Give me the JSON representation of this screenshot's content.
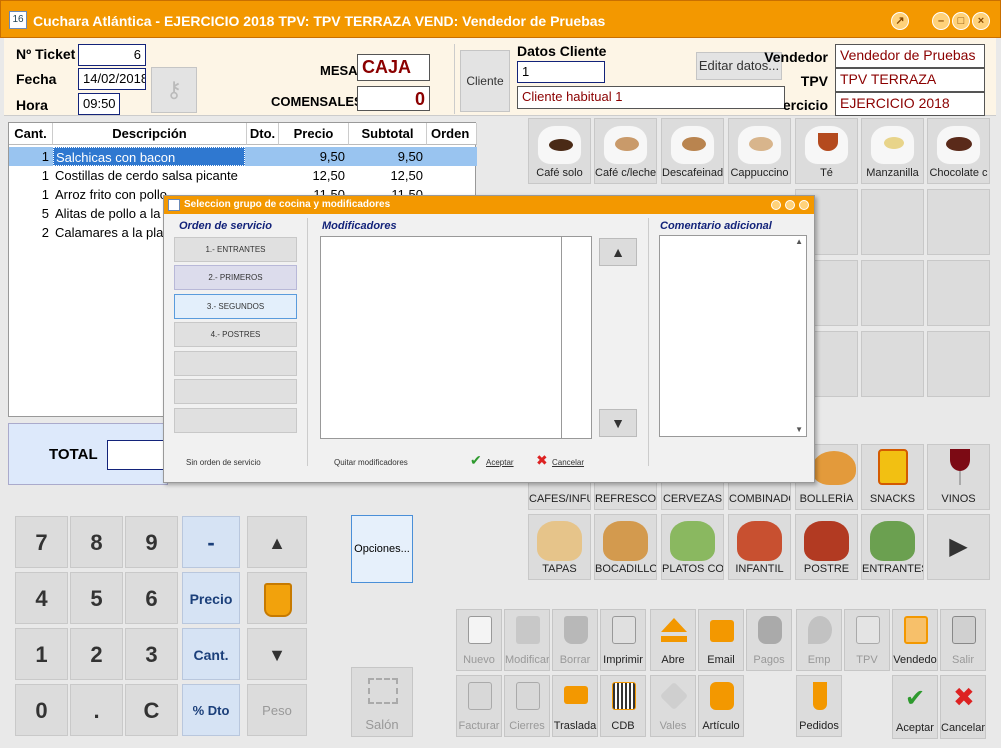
{
  "window": {
    "title": "Cuchara Atlántica - EJERCICIO 2018 TPV: TPV TERRAZA VEND: Vendedor de Pruebas"
  },
  "header": {
    "ticket_label": "Nº Ticket",
    "ticket_value": "6",
    "fecha_label": "Fecha",
    "fecha_value": "14/02/2018",
    "hora_label": "Hora",
    "hora_value": "09:50",
    "mesa_label": "MESA",
    "mesa_value": "CAJA",
    "comensales_label": "COMENSALES",
    "comensales_value": "0",
    "cliente_button": "Cliente",
    "datos_cliente_label": "Datos Cliente",
    "cliente_id": "1",
    "cliente_name": "Cliente habitual 1",
    "editar_button": "Editar datos...",
    "vendedor_label": "Vendedor",
    "vendedor_value": "Vendedor de Pruebas",
    "tpv_label": "TPV",
    "tpv_value": "TPV TERRAZA",
    "ejercicio_label": "Ejercicio",
    "ejercicio_value": "EJERCICIO 2018"
  },
  "table": {
    "columns": [
      "Cant.",
      "Descripción",
      "Dto.",
      "Precio",
      "Subtotal",
      "Orden"
    ],
    "rows": [
      {
        "cant": "1",
        "desc": "Salchicas con bacon",
        "dto": "",
        "precio": "9,50",
        "subtotal": "9,50"
      },
      {
        "cant": "1",
        "desc": "Costillas de cerdo salsa picante",
        "dto": "",
        "precio": "12,50",
        "subtotal": "12,50"
      },
      {
        "cant": "1",
        "desc": "Arroz frito con pollo",
        "dto": "",
        "precio": "11,50",
        "subtotal": "11,50"
      },
      {
        "cant": "5",
        "desc": "Alitas de pollo a la",
        "dto": "",
        "precio": "",
        "subtotal": ""
      },
      {
        "cant": "2",
        "desc": "Calamares a la pla",
        "dto": "",
        "precio": "",
        "subtotal": ""
      }
    ]
  },
  "total_label": "TOTAL",
  "keypad": {
    "k7": "7",
    "k8": "8",
    "k9": "9",
    "minus": "-",
    "k4": "4",
    "k5": "5",
    "k6": "6",
    "precio": "Precio",
    "k1": "1",
    "k2": "2",
    "k3": "3",
    "cant": "Cant.",
    "k0": "0",
    "dot": ".",
    "c": "C",
    "dto": "% Dto",
    "peso": "Peso"
  },
  "opciones_button": "Opciones...",
  "salon_button": "Salón",
  "products": [
    "Café solo",
    "Café c/leche",
    "Descafeinado",
    "Cappuccino",
    "Té",
    "Manzanilla",
    "Chocolate c"
  ],
  "families": [
    "CAFES/INFU",
    "REFRESCOS",
    "CERVEZAS",
    "COMBINADOS",
    "BOLLERÍA",
    "SNACKS",
    "VINOS"
  ],
  "families2": [
    "TAPAS",
    "BOCADILLOS",
    "PLATOS CO",
    "INFANTIL",
    "POSTRE",
    "ENTRANTES"
  ],
  "toolbar1": [
    "Nuevo",
    "Modificar",
    "Borrar",
    "Imprimir",
    "Abre",
    "Email",
    "Pagos",
    "Emp",
    "TPV",
    "Vendedo",
    "Salir"
  ],
  "toolbar2": [
    "Facturar",
    "Cierres",
    "Traslada",
    "CDB",
    "Vales",
    "Artículo",
    "Pedidos",
    "Aceptar",
    "Cancelar"
  ],
  "dialog": {
    "title": "Seleccion grupo de cocina y modificadores",
    "orden_label": "Orden de servicio",
    "mod_label": "Modificadores",
    "coment_label": "Comentario adicional",
    "orders": [
      "1.- ENTRANTES",
      "2.- PRIMEROS",
      "3.- SEGUNDOS",
      "4.- POSTRES"
    ],
    "sin_orden": "Sin orden de servicio",
    "quitar": "Quitar modificadores",
    "aceptar": "Aceptar",
    "cancelar": "Cancelar"
  },
  "colors": {
    "accent": "#f39800",
    "title_text": "#ffffff",
    "field_border": "#13237a",
    "red_text": "#8b0000"
  }
}
